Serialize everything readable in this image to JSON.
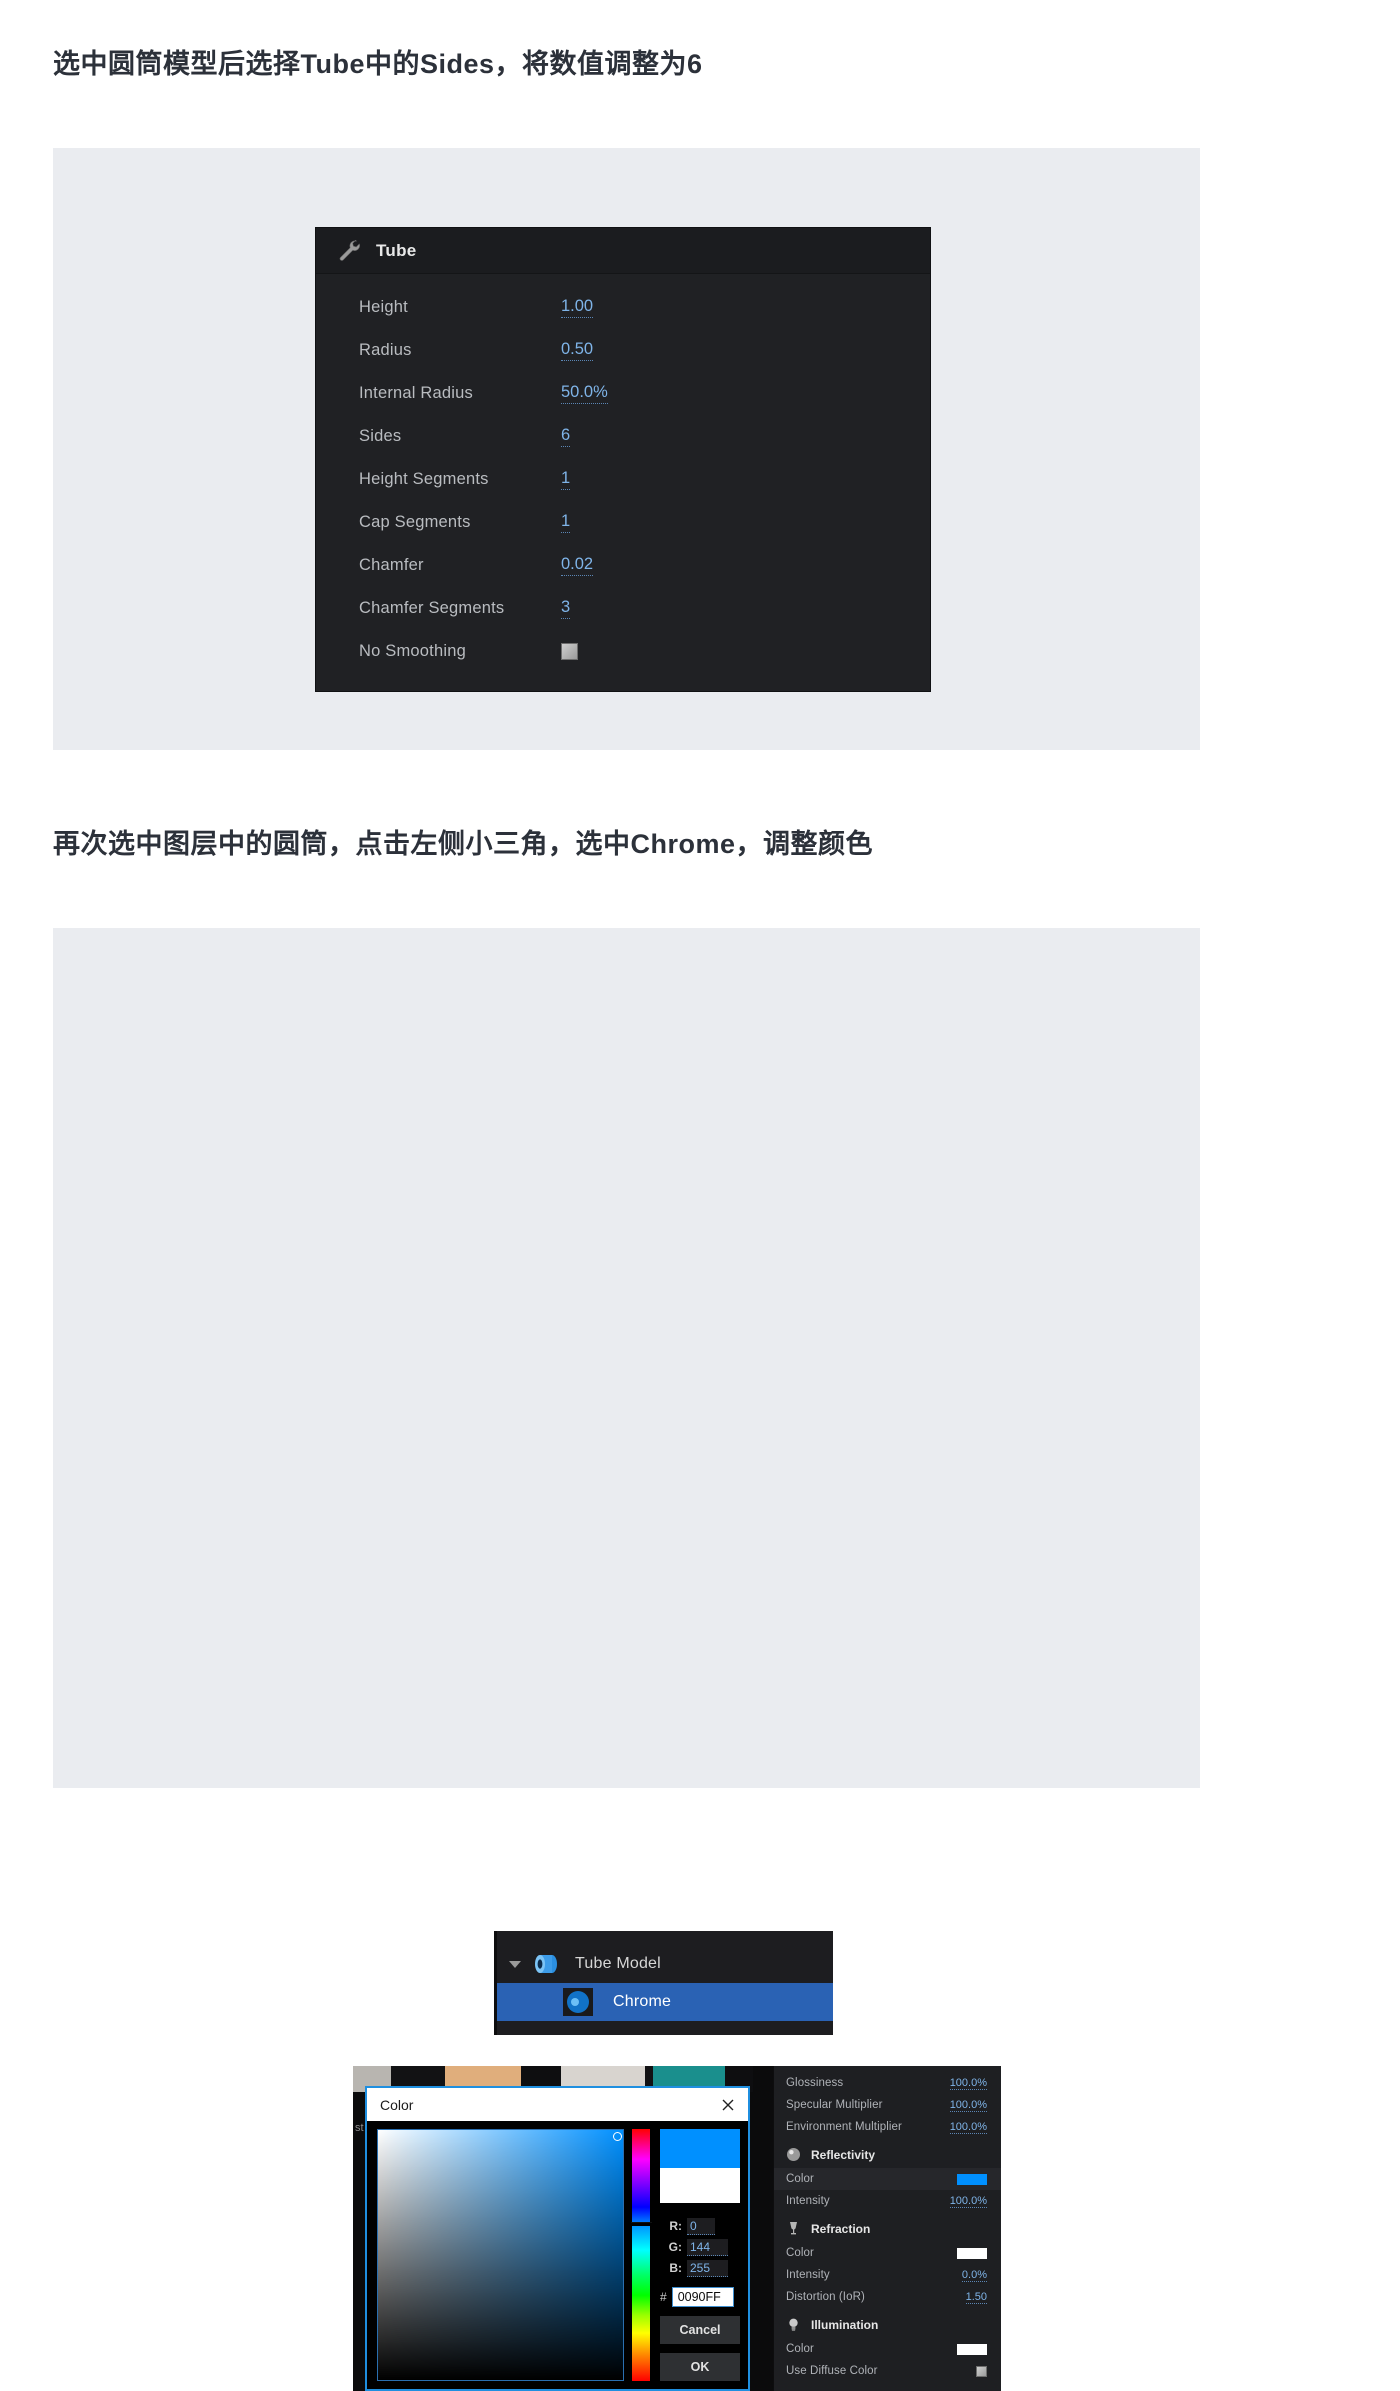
{
  "headings": {
    "step1": "选中圆筒模型后选择Tube中的Sides，将数值调整为6",
    "step2": "再次选中图层中的圆筒，点击左侧小三角，选中Chrome，调整颜色"
  },
  "tube_panel": {
    "title": "Tube",
    "icon": "wrench-icon",
    "properties": [
      {
        "label": "Height",
        "value": "1.00",
        "type": "number"
      },
      {
        "label": "Radius",
        "value": "0.50",
        "type": "number"
      },
      {
        "label": "Internal Radius",
        "value": "50.0%",
        "type": "number"
      },
      {
        "label": "Sides",
        "value": "6",
        "type": "number"
      },
      {
        "label": "Height Segments",
        "value": "1",
        "type": "number"
      },
      {
        "label": "Cap Segments",
        "value": "1",
        "type": "number"
      },
      {
        "label": "Chamfer",
        "value": "0.02",
        "type": "number"
      },
      {
        "label": "Chamfer Segments",
        "value": "3",
        "type": "number"
      },
      {
        "label": "No Smoothing",
        "value": "",
        "type": "checkbox"
      }
    ]
  },
  "layer_panel": {
    "rows": [
      {
        "name": "Tube Model",
        "icon": "tube-model-icon",
        "selected": false,
        "expanded": true
      },
      {
        "name": "Chrome",
        "icon": "chrome-material-icon",
        "selected": true,
        "expanded": false
      }
    ]
  },
  "color_dialog": {
    "title": "Color",
    "close_label": "×",
    "rgb": [
      {
        "label": "R:",
        "value": "0"
      },
      {
        "label": "G:",
        "value": "144"
      },
      {
        "label": "B:",
        "value": "255"
      }
    ],
    "hex_prefix": "#",
    "hex_value": "0090FF",
    "cancel_label": "Cancel",
    "ok_label": "OK",
    "new_color": "#0090FF",
    "old_color": "#FFFFFF",
    "side_text": "st"
  },
  "material_panel": {
    "rows": [
      {
        "label": "Glossiness",
        "value": "100.0%",
        "type": "number"
      },
      {
        "label": "Specular Multiplier",
        "value": "100.0%",
        "type": "number"
      },
      {
        "label": "Environment Multiplier",
        "value": "100.0%",
        "type": "number"
      }
    ],
    "sections": [
      {
        "title": "Reflectivity",
        "icon": "sphere-icon",
        "rows": [
          {
            "label": "Color",
            "value": "#0090FF",
            "type": "swatch",
            "highlight": true
          },
          {
            "label": "Intensity",
            "value": "100.0%",
            "type": "number"
          }
        ]
      },
      {
        "title": "Refraction",
        "icon": "glass-icon",
        "rows": [
          {
            "label": "Color",
            "value": "#FFFFFF",
            "type": "swatch"
          },
          {
            "label": "Intensity",
            "value": "0.0%",
            "type": "number"
          },
          {
            "label": "Distortion (IoR)",
            "value": "1.50",
            "type": "number"
          }
        ]
      },
      {
        "title": "Illumination",
        "icon": "bulb-icon",
        "rows": [
          {
            "label": "Color",
            "value": "#FFFFFF",
            "type": "swatch"
          },
          {
            "label": "Use Diffuse Color",
            "value": "",
            "type": "checkbox"
          }
        ]
      }
    ]
  }
}
